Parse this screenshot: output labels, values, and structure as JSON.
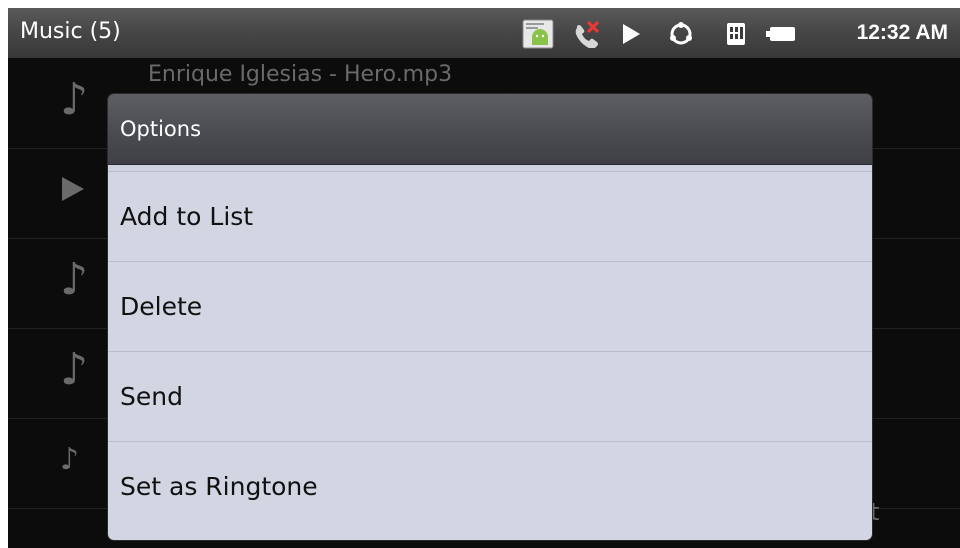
{
  "status_bar": {
    "app_title": "Music (5)",
    "time": "12:32 AM",
    "icons": [
      "android-notification-icon",
      "missed-call-icon",
      "play-icon",
      "sync-icon",
      "sd-card-icon",
      "battery-icon"
    ]
  },
  "music_list": {
    "items": [
      {
        "title": "Enrique Iglesias - Hero.mp3",
        "icon": "music-note-icon"
      },
      {
        "title": "",
        "icon": "play-icon"
      },
      {
        "title": "",
        "icon": "music-note-icon"
      },
      {
        "title": "",
        "icon": "music-note-icon"
      },
      {
        "title": "",
        "icon": "music-note-icon"
      }
    ],
    "partial_text": "t"
  },
  "dialog": {
    "title": "Options",
    "items": [
      {
        "label": "Add to List"
      },
      {
        "label": "Delete"
      },
      {
        "label": "Send"
      },
      {
        "label": "Set as Ringtone"
      }
    ]
  },
  "colors": {
    "status_bar": "#474747",
    "dialog_header": "#4b4d52",
    "dialog_body": "#d2d6e3",
    "list_background": "#0c0c0c"
  }
}
